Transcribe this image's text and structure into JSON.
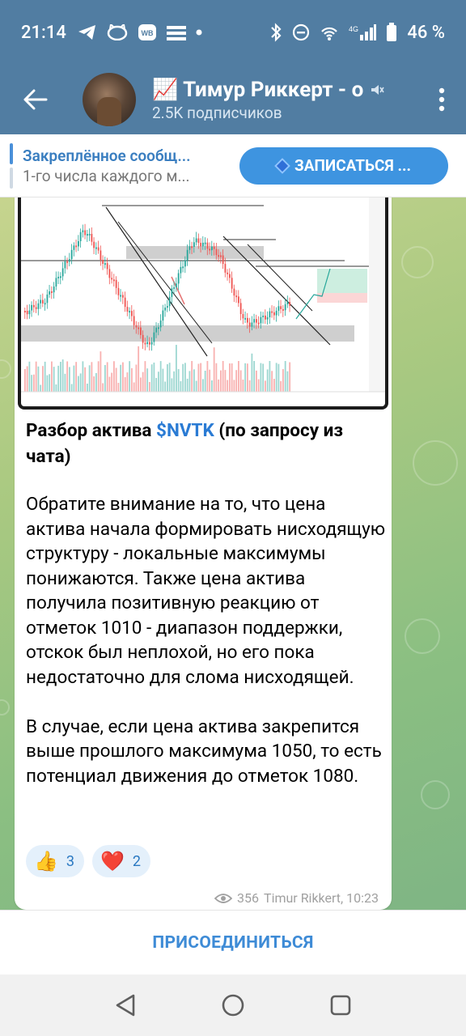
{
  "status_bar": {
    "time": "21:14",
    "battery": "46 %",
    "icons": [
      "telegram-icon",
      "cat-icon",
      "wb-icon",
      "list-icon",
      "dot-icon",
      "bluetooth-icon",
      "dnd-icon",
      "wifi-call-icon",
      "signal-icon",
      "battery-icon"
    ]
  },
  "header": {
    "title": "📈 Тимур Риккерт - о",
    "subtitle": "2.5K подписчиков"
  },
  "pinned": {
    "title": "Закреплённое сообщ...",
    "text": "1-го числа каждого м...",
    "button_label": "ЗАПИСАТЬСЯ ..."
  },
  "post": {
    "title_prefix": "Разбор актива ",
    "ticker": "$NVTK",
    "title_suffix": " (по запросу из чата)",
    "body": "Обратите внимание на то, что цена актива начала формировать нисходящую структуру - локальные максимумы понижаются. Также цена актива получила позитивную реакцию от отметок 1010 - диапазон поддержки, отскок был неплохой, но его пока недостаточно для слома нисходящей.\n\nВ случае, если цена актива закрепится выше прошлого максимума 1050, то есть потенциал движения до отметок 1080.",
    "reactions": [
      {
        "emoji": "👍",
        "count": "3"
      },
      {
        "emoji": "❤️",
        "count": "2"
      }
    ],
    "views": "356",
    "author_time": "Timur Rikkert, 10:23"
  },
  "join_label": "ПРИСОЕДИНИТЬСЯ",
  "colors": {
    "header_bg": "#517da2",
    "accent": "#3e94e0",
    "up_candle": "#26a69a",
    "down_candle": "#ef5350"
  }
}
